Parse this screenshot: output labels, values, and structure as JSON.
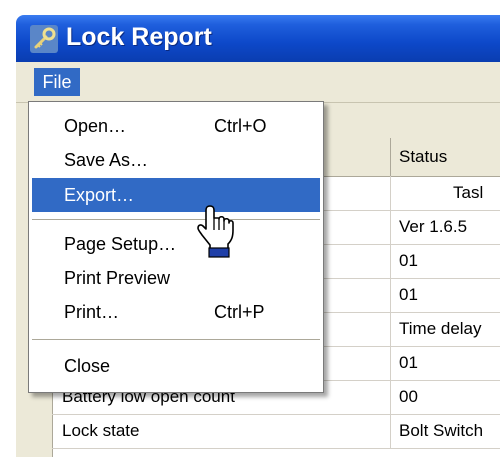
{
  "window": {
    "title": "Lock Report"
  },
  "menubar": {
    "file_label": "File"
  },
  "file_menu": {
    "items": [
      {
        "label": "Open…",
        "shortcut": "Ctrl+O"
      },
      {
        "label": "Save As…",
        "shortcut": ""
      },
      {
        "label": "Export…",
        "shortcut": ""
      },
      {
        "label": "Page Setup…",
        "shortcut": ""
      },
      {
        "label": "Print Preview",
        "shortcut": ""
      },
      {
        "label": "Print…",
        "shortcut": "Ctrl+P"
      },
      {
        "label": "Close",
        "shortcut": ""
      }
    ],
    "highlighted": "Export…"
  },
  "table": {
    "status_header": "Status",
    "rows": [
      {
        "name": "",
        "status": "Tasl"
      },
      {
        "name": "",
        "status": "Ver 1.6.5"
      },
      {
        "name": "",
        "status": "01"
      },
      {
        "name": "",
        "status": "01"
      },
      {
        "name": "",
        "status": "Time delay"
      },
      {
        "name": "",
        "status": "01"
      },
      {
        "name": "Battery low open count",
        "status": "00"
      },
      {
        "name": "Lock state",
        "status": "Bolt Switch"
      }
    ]
  },
  "colors": {
    "titlebar": "#0d48c9",
    "highlight": "#316ac5",
    "chrome": "#ece9d8"
  },
  "icons": {
    "app": "key-icon",
    "cursor": "hand-pointer-icon"
  }
}
